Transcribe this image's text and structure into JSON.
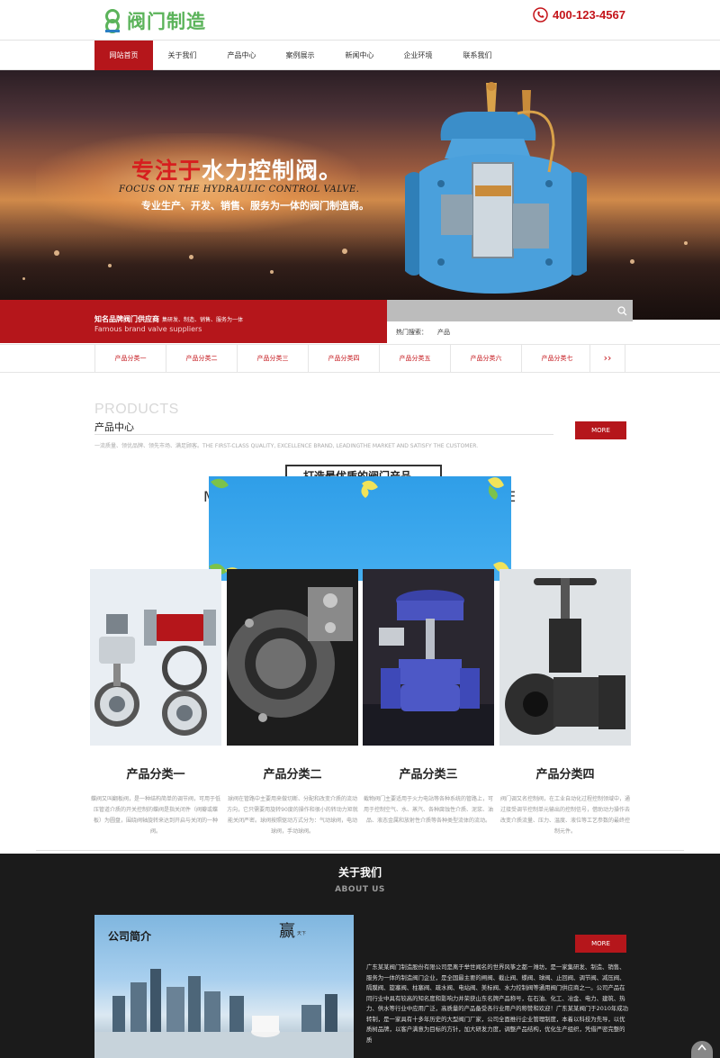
{
  "header": {
    "logo_text": "阀门制造",
    "phone": "400-123-4567"
  },
  "nav": {
    "items": [
      {
        "label": "网站首页",
        "active": true
      },
      {
        "label": "关于我们",
        "active": false
      },
      {
        "label": "产品中心",
        "active": false
      },
      {
        "label": "案例展示",
        "active": false
      },
      {
        "label": "新闻中心",
        "active": false
      },
      {
        "label": "企业环境",
        "active": false
      },
      {
        "label": "联系我们",
        "active": false
      }
    ]
  },
  "banner": {
    "title_red": "专注于",
    "title_white": "水力控制阀。",
    "title_en": "FOCUS ON THE HYDRAULIC CONTROL VALVE.",
    "desc": "专业生产、开发、销售、服务为一体的阀门制造商。"
  },
  "tagline": {
    "cn": "知名品牌阀门供应商",
    "cn_small": "集研发、制造、销售、服务为一体",
    "en": "Famous brand valve suppliers"
  },
  "search": {
    "placeholder": "",
    "hot_label": "热门搜索：",
    "hot_item": "产品"
  },
  "categories": [
    "产品分类一",
    "产品分类二",
    "产品分类三",
    "产品分类四",
    "产品分类五",
    "产品分类六",
    "产品分类七"
  ],
  "category_next": "››",
  "products": {
    "heading_en": "PRODUCTS",
    "heading_cn": "产品中心",
    "slogan": "一流质量、领优品牌、领先市场、满足顾客。THE FIRST-CLASS QUALITY, EXCELLENCE BRAND, LEADINGTHE MARKET AND SATISFY THE CUSTOMER.",
    "more": "MORE",
    "motto": "打造最优质的阀门产品",
    "motto_left": "M",
    "motto_right": "E",
    "items": [
      {
        "title": "产品分类一",
        "desc": "蝶阀又叫翻板阀，是一种结构简单的调节阀，可用于低压管道介质的开关控制的蝶阀是指关闭件（阀瓣或蝶板）为圆盘，围绕阀轴旋转来达到开启与关闭的一种阀。"
      },
      {
        "title": "产品分类二",
        "desc": "球阀在管路中主要用来做切断、分配和改变介质的流动方向，它只需要用旋转90度的操作和很小的转动力矩就能关闭严密。球阀按照驱动方式分为：气动球阀，电动球阀，手动球阀。"
      },
      {
        "title": "产品分类三",
        "desc": "截物阀门主要适用于火力电站等各种系统的管路上，可用于控制空气、水、蒸汽、各种腐蚀性介质、泥浆、油品、液态金属和放射性介质等各种类型流体的流动。"
      },
      {
        "title": "产品分类四",
        "desc": "阀门调又名控制阀，在工业自动化过程控制领域中，通过接受调节控制单元输出的控制信号，借助动力操作去改变介质流量、压力、温度、液位等工艺参数的最终控制元件。"
      }
    ]
  },
  "about": {
    "heading_cn": "关于我们",
    "heading_en": "ABOUT US",
    "more": "MORE",
    "image_title": "公司简介",
    "image_word": "赢",
    "image_small": "天下",
    "text": "广东某某阀门制造股份有限公司是离于举世闻名的世界风筝之都－潍坊，是一家集研发、制造、销售、服务为一体的制造阀门企业，是全国最主要的闸阀、截止阀、蝶阀、球阀、止回阀、调节阀、减压阀、隔膜阀、旋塞阀、柱塞阀、疏水阀、电站阀、美标阀、水力控制阀等通用阀门供应商之一。公司产品在同行业中具有较高的知名度和影响力并荣获山东名牌产品称号，在石油、化工、冶金、电力、建筑、热力、供水等行业中应用广泛，高质量的产品备受各行业用户的称赞和欢迎！广东某某阀门于2010年成功转制，是一家具有十多年历史的大型阀门厂家，公司全面推行企业管理制度，本着以科技为先导，以优质树品牌，以客户满意为目标的方针，加大研发力度，调整产品结构，优化生产组织，凭借严密完整的质"
  },
  "colors": {
    "brand_red": "#b5161b",
    "logo_green": "#5bb35a",
    "popup_blue": "#2f9ee8",
    "about_bg": "#1b1b1b"
  }
}
